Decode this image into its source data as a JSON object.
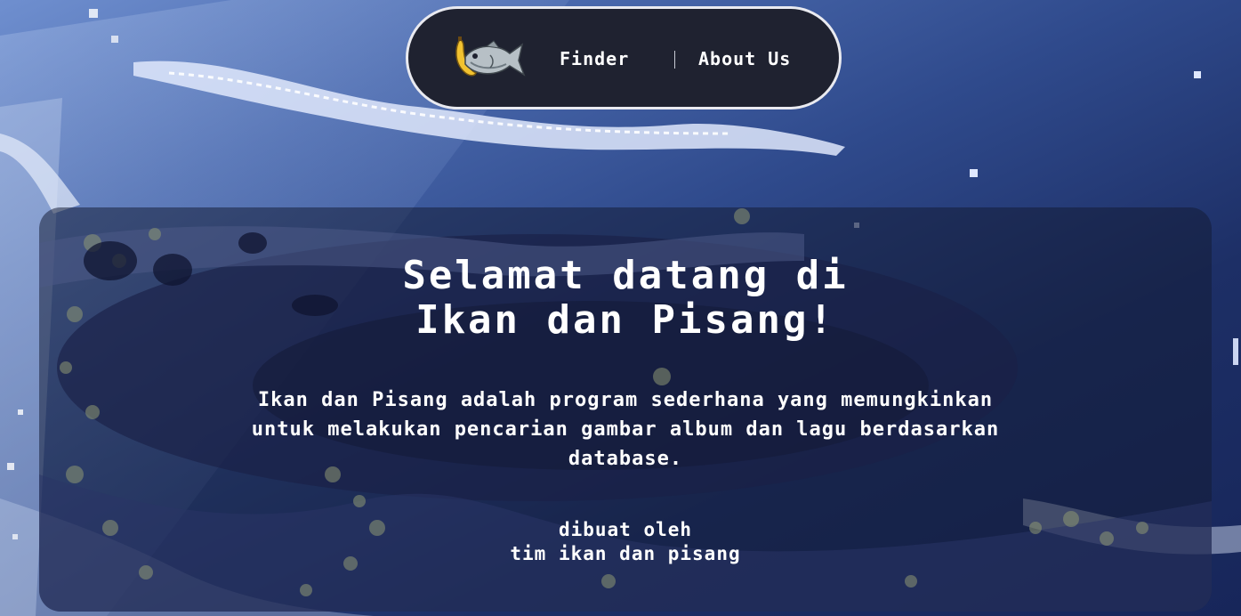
{
  "nav": {
    "logo_icon": "fish-banana-logo-icon",
    "links": [
      {
        "label": "Finder"
      },
      {
        "label": "About Us"
      }
    ]
  },
  "hero": {
    "title_line1": "Selamat datang di",
    "title_line2": "Ikan dan Pisang!",
    "description_line1": "Ikan dan Pisang adalah program sederhana yang memungkinkan",
    "description_line2": "untuk melakukan pencarian gambar album dan lagu berdasarkan",
    "description_line3": "database.",
    "credit_line1": "dibuat oleh",
    "credit_line2": "tim ikan dan pisang"
  },
  "colors": {
    "nav_bg": "#1f2230",
    "nav_border": "#e9eaf0",
    "text": "#ffffff",
    "sky_light": "#6f8fcf",
    "sky_dark": "#17265a"
  }
}
